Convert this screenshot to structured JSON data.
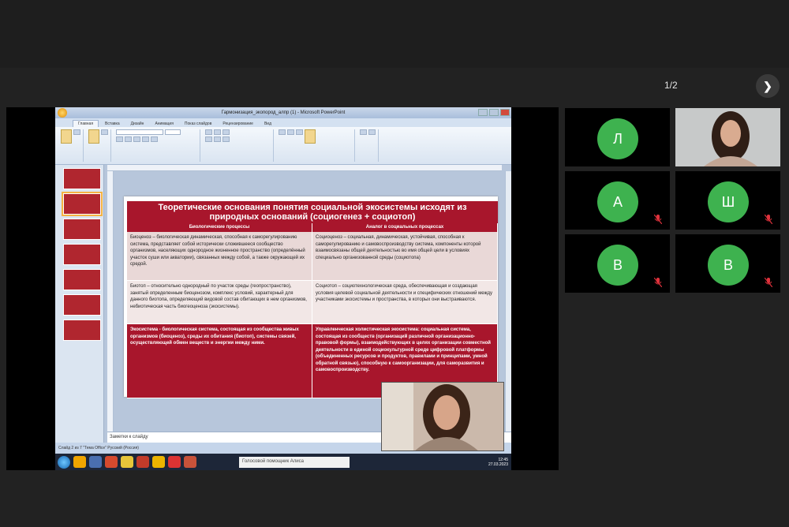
{
  "conference": {
    "page_indicator": "1/2",
    "next_icon": "chevron-right-icon"
  },
  "powerpoint": {
    "window_title": "Гармонизация_экопород_алпр (1) - Microsoft PowerPoint",
    "tabs": [
      "Главная",
      "Вставка",
      "Дизайн",
      "Анимация",
      "Показ слайдов",
      "Рецензирование",
      "Вид"
    ],
    "notes_placeholder": "Заметки к слайду",
    "status_text": "Слайд 2 из 7    \"Тема Office\"    Русский (Россия)",
    "taskbar": {
      "search_text": "Голосовой помощник Алиса",
      "clock_time": "12:45",
      "clock_date": "27.03.2023"
    },
    "slide": {
      "title_line1": "Теоретические основания понятия социальной экосистемы исходят из",
      "title_line2": "природных оснований (социогенез + социотоп)",
      "col_left": "Биологические процессы",
      "col_right": "Аналог в социальных процессах",
      "rows": [
        {
          "left": "Биоценоз – биологическая динамическая, способная к саморегулированию система, представляет собой исторически сложившееся сообщество организмов, населяющих однородное жизненное пространство (определённый участок суши или акватории), связанных между собой, а также окружающей их средой.",
          "right": "Социоценоз – социальная, динамическая, устойчивая, способная к саморегулированию и самовоспроизводству система, компоненты которой взаимосвязаны общей деятельностью во имя общей цели в условиях специально организованной среды (социотопа)"
        },
        {
          "left": "Биотоп – относительно однородный по участок среды (геопространство), занятый определенным биоценозом, комплекс условий, характерный для данного биотопа, определяющий видовой состав обитающих в нем организмов, небиотическая часть биогеоценоза (экосистемы).",
          "right": "Социотоп – социотехнологическая среда, обеспечивающая и создающая условия целевой социальной деятельности и специфических отношений между участниками экосистемы и пространства, в которых они выстраиваются."
        },
        {
          "left": "Экосистема - биологическая система, состоящая из сообщества живых организмов (биоценоз), среды их обитания (биотоп), системы связей, осуществляющей обмен веществ и энергии между ними.",
          "right": "Управленческая холистическая экосистема: социальная система, состоящая из сообществ (организаций различной организационно-правовой формы), взаимодействующих в целях организации совместной деятельности в единой социокультурной среде цифровой платформы (объединенных ресурсов и продуктов, правилами и принципами, умной обратной связью), способную к самоорганизации, для саморазвития и самовоспроизводству."
        }
      ]
    }
  },
  "participants": [
    {
      "initial": "Л",
      "muted": false
    },
    {
      "initial": "",
      "video": true
    },
    {
      "initial": "А",
      "muted": true
    },
    {
      "initial": "Ш",
      "muted": true
    },
    {
      "initial": "В",
      "muted": true
    },
    {
      "initial": "В",
      "muted": true
    }
  ],
  "colors": {
    "avatar_green": "#3eb24f",
    "slide_red": "#a8162c",
    "muted_red": "#e0323c"
  }
}
